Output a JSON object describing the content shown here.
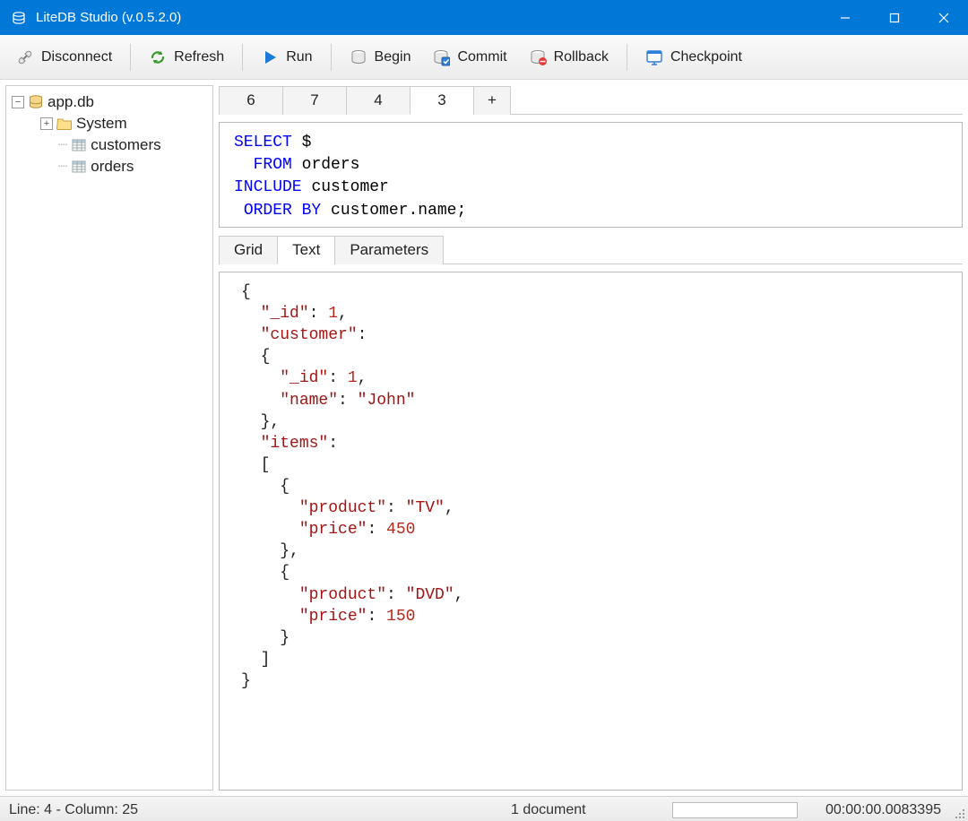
{
  "window": {
    "title": "LiteDB Studio (v.0.5.2.0)"
  },
  "toolbar": {
    "disconnect": "Disconnect",
    "refresh": "Refresh",
    "run": "Run",
    "begin": "Begin",
    "commit": "Commit",
    "rollback": "Rollback",
    "checkpoint": "Checkpoint"
  },
  "tree": {
    "db": "app.db",
    "system": "System",
    "collections": [
      "customers",
      "orders"
    ]
  },
  "query_tabs": [
    "6",
    "7",
    "4",
    "3"
  ],
  "query_tab_active_index": 3,
  "query_parts": {
    "select": "SELECT",
    "dollar": "$",
    "from": "FROM",
    "from_target": "orders",
    "include": "INCLUDE",
    "include_target": "customer",
    "order_by": "ORDER BY",
    "order_by_target": "customer.name;"
  },
  "result_tabs": [
    "Grid",
    "Text",
    "Parameters"
  ],
  "result_tab_active_index": 1,
  "result": {
    "id_key": "\"_id\"",
    "id_val": "1",
    "customer_key": "\"customer\"",
    "cust_id_key": "\"_id\"",
    "cust_id_val": "1",
    "cust_name_key": "\"name\"",
    "cust_name_val": "\"John\"",
    "items_key": "\"items\"",
    "p0_prod_key": "\"product\"",
    "p0_prod_val": "\"TV\"",
    "p0_price_key": "\"price\"",
    "p0_price_val": "450",
    "p1_prod_key": "\"product\"",
    "p1_prod_val": "\"DVD\"",
    "p1_price_key": "\"price\"",
    "p1_price_val": "150"
  },
  "status": {
    "cursor": "Line: 4 - Column: 25",
    "docs": "1 document",
    "elapsed": "00:00:00.0083395"
  }
}
